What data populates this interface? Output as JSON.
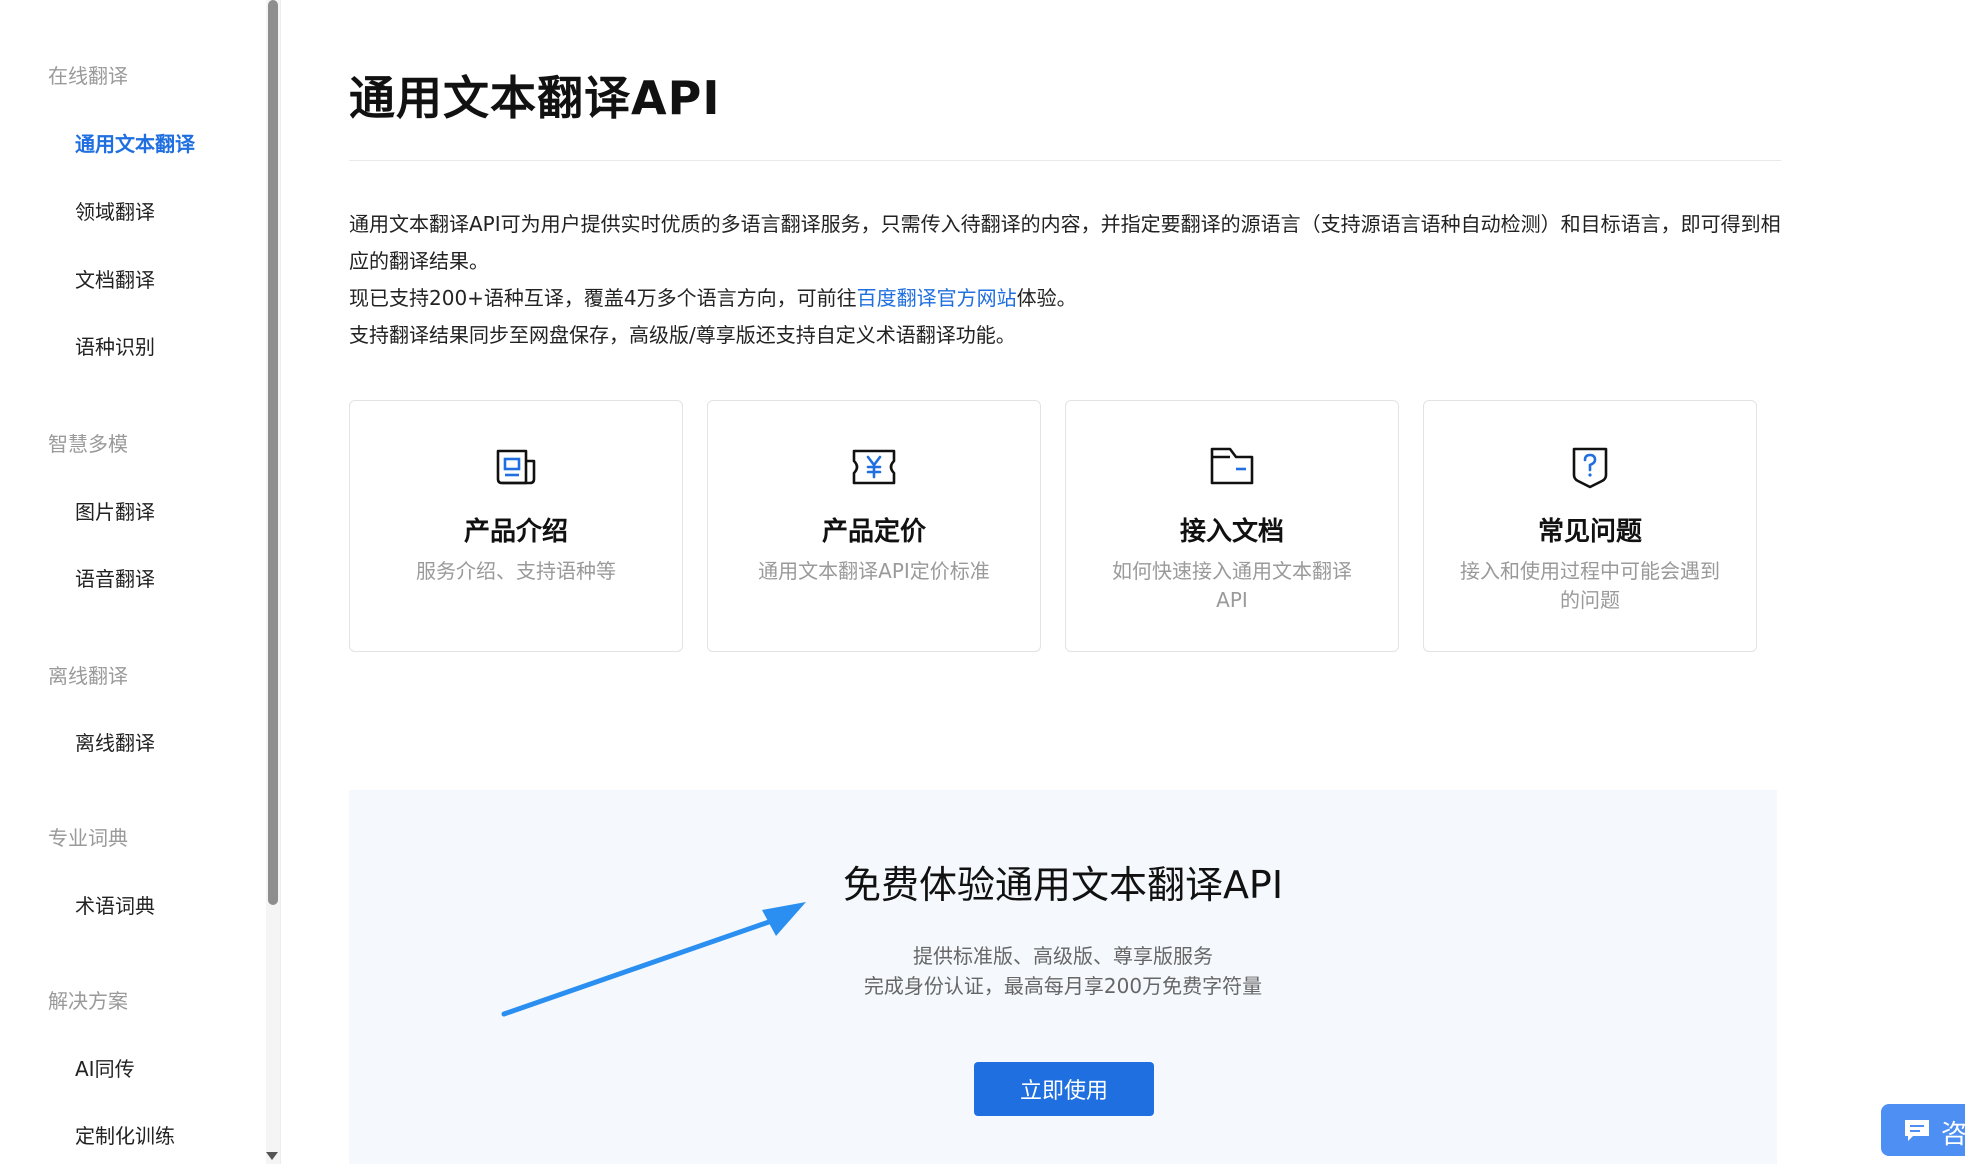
{
  "sidebar": {
    "groups": [
      {
        "title": "在线翻译",
        "items": [
          "通用文本翻译",
          "领域翻译",
          "文档翻译",
          "语种识别"
        ]
      },
      {
        "title": "智慧多模",
        "items": [
          "图片翻译",
          "语音翻译"
        ]
      },
      {
        "title": "离线翻译",
        "items": [
          "离线翻译"
        ]
      },
      {
        "title": "专业词典",
        "items": [
          "术语词典"
        ]
      },
      {
        "title": "解决方案",
        "items": [
          "AI同传",
          "定制化训练"
        ]
      }
    ],
    "active_item": "通用文本翻译"
  },
  "main": {
    "title": "通用文本翻译API",
    "description": {
      "line1": "通用文本翻译API可为用户提供实时优质的多语言翻译服务，只需传入待翻译的内容，并指定要翻译的源语言（支持源语言语种自动检测）和目标语言，即可得到相应的翻译结果。",
      "line2_prefix": "现已支持200+语种互译，覆盖4万多个语言方向，可前往",
      "line2_link": "百度翻译官方网站",
      "line2_suffix": "体验。",
      "line3": "支持翻译结果同步至网盘保存，高级版/尊享版还支持自定义术语翻译功能。"
    },
    "cards": [
      {
        "title": "产品介绍",
        "desc": "服务介绍、支持语种等",
        "icon": "document-icon"
      },
      {
        "title": "产品定价",
        "desc": "通用文本翻译API定价标准",
        "icon": "yuan-ticket-icon"
      },
      {
        "title": "接入文档",
        "desc": "如何快速接入通用文本翻译API",
        "icon": "folder-icon"
      },
      {
        "title": "常见问题",
        "desc": "接入和使用过程中可能会遇到的问题",
        "icon": "question-shield-icon"
      }
    ],
    "banner": {
      "title": "免费体验通用文本翻译API",
      "sub1": "提供标准版、高级版、尊享版服务",
      "sub2": "完成身份认证，最高每月享200万免费字符量",
      "button": "立即使用"
    }
  },
  "consult": {
    "text": "咨",
    "icon": "chat-icon"
  },
  "colors": {
    "accent": "#1f6fe0",
    "banner_bg": "#f5f9fd",
    "annotation_arrow": "#2a8ff0"
  }
}
